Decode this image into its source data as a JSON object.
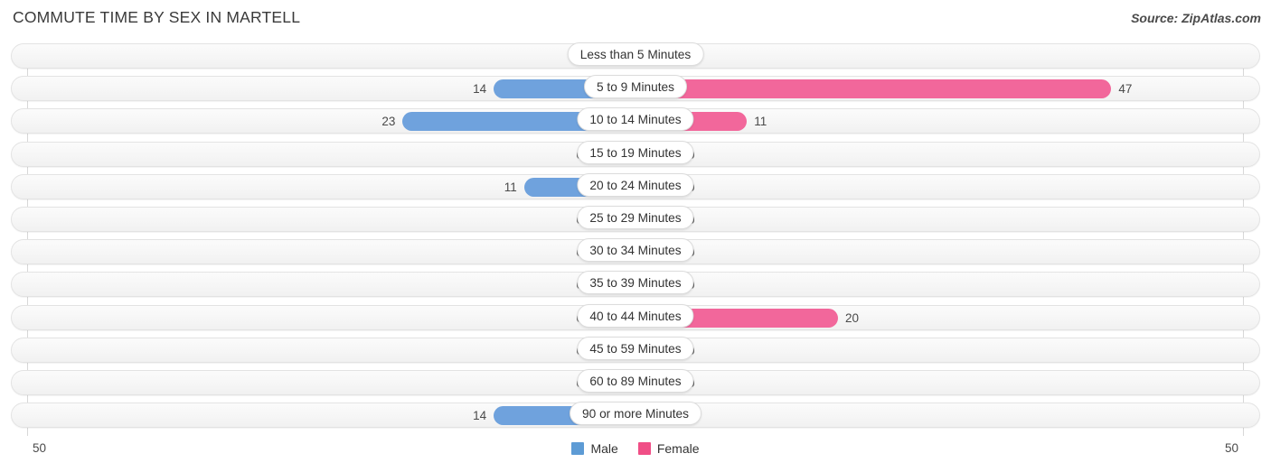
{
  "header": {
    "title": "COMMUTE TIME BY SEX IN MARTELL",
    "source": "Source: ZipAtlas.com"
  },
  "axis": {
    "left_label": "50",
    "right_label": "50",
    "max": 50
  },
  "legend": {
    "items": [
      {
        "label": "Male",
        "color": "#5d9bd5"
      },
      {
        "label": "Female",
        "color": "#f04e86"
      }
    ]
  },
  "colors": {
    "male": "#6fa2dd",
    "male_zero": "#a9c7ea",
    "female": "#f2679b",
    "female_zero": "#f7a0c0",
    "male_accent": "#5d9bd5",
    "female_accent": "#f04e86"
  },
  "chart_data": {
    "type": "bar",
    "title": "COMMUTE TIME BY SEX IN MARTELL",
    "subtitle": "Source: ZipAtlas.com",
    "orientation": "horizontal-diverging",
    "xlabel": "",
    "ylabel": "",
    "xlim": [
      -50,
      50
    ],
    "axis_tick_labels": [
      "50",
      "50"
    ],
    "grid": true,
    "legend_position": "bottom-center",
    "categories": [
      "Less than 5 Minutes",
      "5 to 9 Minutes",
      "10 to 14 Minutes",
      "15 to 19 Minutes",
      "20 to 24 Minutes",
      "25 to 29 Minutes",
      "30 to 34 Minutes",
      "35 to 39 Minutes",
      "40 to 44 Minutes",
      "45 to 59 Minutes",
      "60 to 89 Minutes",
      "90 or more Minutes"
    ],
    "series": [
      {
        "name": "Male",
        "color": "#5d9bd5",
        "side": "left",
        "values": [
          0,
          14,
          23,
          0,
          11,
          0,
          0,
          0,
          0,
          0,
          0,
          14
        ]
      },
      {
        "name": "Female",
        "color": "#f04e86",
        "side": "right",
        "values": [
          0,
          47,
          11,
          0,
          0,
          0,
          0,
          0,
          20,
          0,
          0,
          0
        ]
      }
    ]
  },
  "rows": [
    {
      "label": "Less than 5 Minutes",
      "male": 0,
      "male_text": "0",
      "female": 0,
      "female_text": "0"
    },
    {
      "label": "5 to 9 Minutes",
      "male": 14,
      "male_text": "14",
      "female": 47,
      "female_text": "47"
    },
    {
      "label": "10 to 14 Minutes",
      "male": 23,
      "male_text": "23",
      "female": 11,
      "female_text": "11"
    },
    {
      "label": "15 to 19 Minutes",
      "male": 0,
      "male_text": "0",
      "female": 0,
      "female_text": "0"
    },
    {
      "label": "20 to 24 Minutes",
      "male": 11,
      "male_text": "11",
      "female": 0,
      "female_text": "0"
    },
    {
      "label": "25 to 29 Minutes",
      "male": 0,
      "male_text": "0",
      "female": 0,
      "female_text": "0"
    },
    {
      "label": "30 to 34 Minutes",
      "male": 0,
      "male_text": "0",
      "female": 0,
      "female_text": "0"
    },
    {
      "label": "35 to 39 Minutes",
      "male": 0,
      "male_text": "0",
      "female": 0,
      "female_text": "0"
    },
    {
      "label": "40 to 44 Minutes",
      "male": 0,
      "male_text": "0",
      "female": 20,
      "female_text": "20"
    },
    {
      "label": "45 to 59 Minutes",
      "male": 0,
      "male_text": "0",
      "female": 0,
      "female_text": "0"
    },
    {
      "label": "60 to 89 Minutes",
      "male": 0,
      "male_text": "0",
      "female": 0,
      "female_text": "0"
    },
    {
      "label": "90 or more Minutes",
      "male": 14,
      "male_text": "14",
      "female": 0,
      "female_text": "0"
    }
  ]
}
